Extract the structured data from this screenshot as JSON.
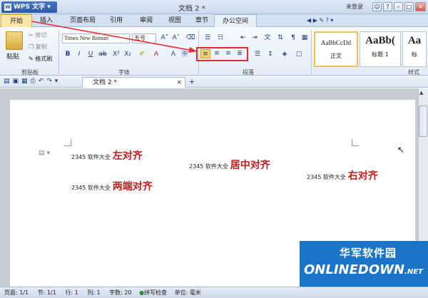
{
  "titlebar": {
    "app": "WPS 文字",
    "document_title": "文档 2 *",
    "login": "未登录"
  },
  "tabs": [
    "开始",
    "插入",
    "页面布局",
    "引用",
    "审阅",
    "视图",
    "章节",
    "办公空间"
  ],
  "ribbon": {
    "paste": "粘贴",
    "cut": "剪切",
    "copy": "复制",
    "format_painter": "格式刷",
    "font_name": "Times New Roman",
    "font_size": "五号",
    "group_clipboard": "剪贴板",
    "group_font": "字体",
    "group_paragraph": "段落",
    "group_styles": "样式",
    "styles": [
      {
        "preview": "AaBbCcDd",
        "name": "正文"
      },
      {
        "preview": "AaBb(",
        "name": "标题 1"
      },
      {
        "preview": "Aa",
        "name": "标"
      }
    ]
  },
  "doc_tab": "文档 2 *",
  "document": {
    "lines": [
      {
        "prefix": "2345 软件大全",
        "label": "左对齐"
      },
      {
        "prefix": "2345 软件大全",
        "label": "居中对齐"
      },
      {
        "prefix": "2345 软件大全",
        "label": "右对齐"
      },
      {
        "prefix": "2345 软件大全",
        "label": "两端对齐"
      }
    ]
  },
  "status": {
    "page": "页面: 1/1",
    "section": "节: 1/1",
    "line": "行: 1",
    "column": "列: 1",
    "wordcount": "字数: 20",
    "spellcheck": "拼写检查",
    "unit": "单位: 毫米"
  },
  "watermark": {
    "cn": "华军软件园",
    "en": "ONLINEDOWN",
    "suffix": ".NET"
  },
  "colors": {
    "highlight": "#e3292e",
    "accent": "#2b59a6",
    "red_text": "#c61a1a"
  }
}
